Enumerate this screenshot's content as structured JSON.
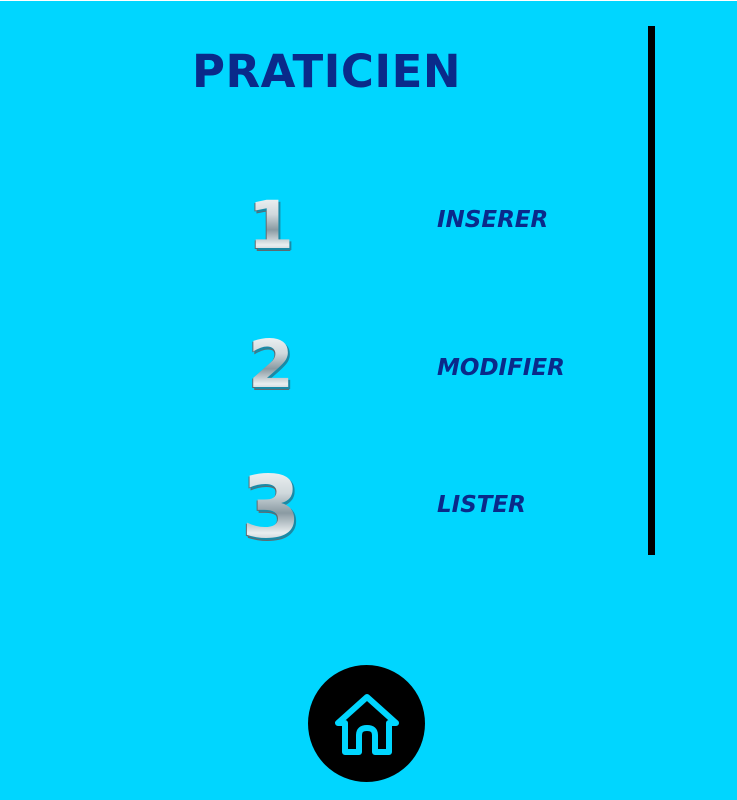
{
  "page": {
    "title": "PRATICIEN"
  },
  "menu": {
    "items": [
      {
        "number": "1",
        "label": "INSERER"
      },
      {
        "number": "2",
        "label": "MODIFIER"
      },
      {
        "number": "3",
        "label": "LISTER"
      }
    ]
  },
  "home": {
    "icon": "home-icon"
  },
  "colors": {
    "background": "#00D6FF",
    "title": "#0A2A8A",
    "divider": "#000000",
    "home_button": "#000000",
    "home_icon": "#00D6FF"
  }
}
